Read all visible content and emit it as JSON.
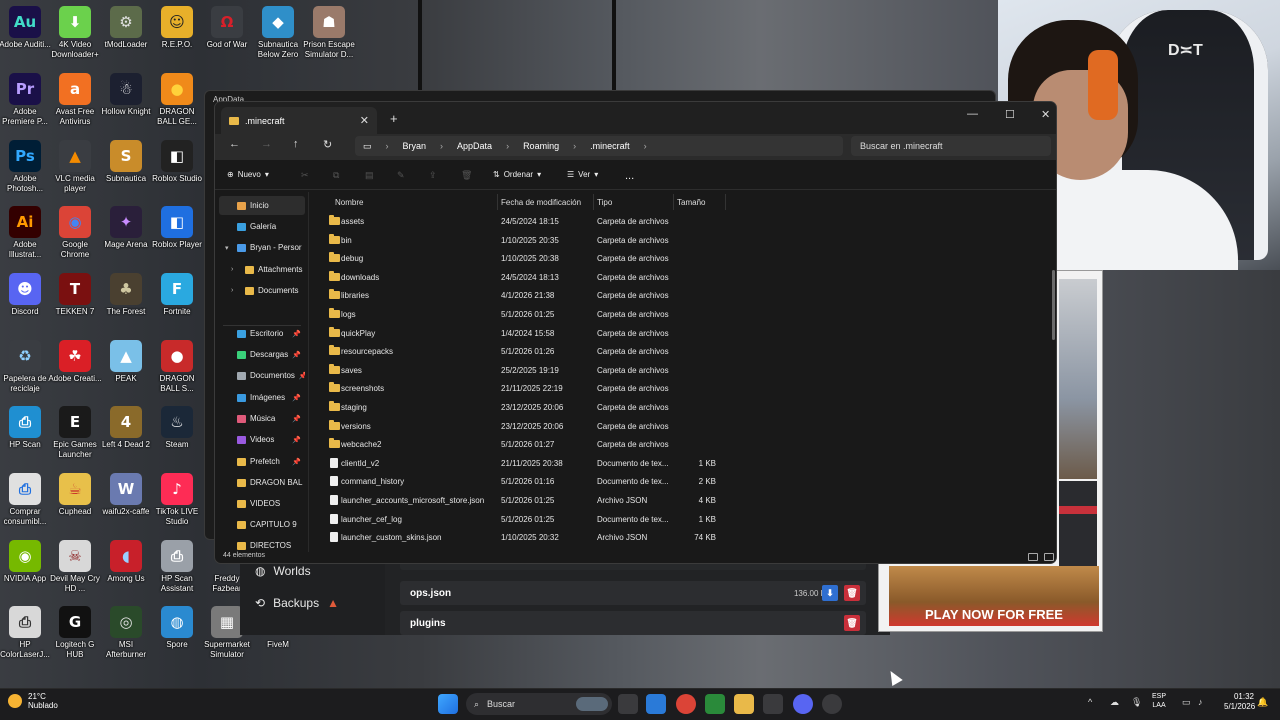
{
  "desktop_icons": [
    {
      "label": "Adobe Auditi...",
      "glyph": "Au",
      "color": "#1a1048",
      "fg": "#41dcc8",
      "icon": "audition-icon"
    },
    {
      "label": "4K Video Downloader+",
      "glyph": "⬇",
      "color": "#6bd14c",
      "fg": "#fff",
      "icon": "download-icon"
    },
    {
      "label": "tModLoader",
      "glyph": "⚙",
      "color": "#5c6b4a",
      "fg": "#e0e0e0",
      "icon": "tmodloader-icon"
    },
    {
      "label": "R.E.P.O.",
      "glyph": "☺",
      "color": "#e8b02a",
      "fg": "#222",
      "icon": "repo-icon"
    },
    {
      "label": "God of War",
      "glyph": "Ω",
      "color": "#3a3d42",
      "fg": "#d8202a",
      "icon": "godofwar-icon"
    },
    {
      "label": "Subnautica Below Zero",
      "glyph": "◆",
      "color": "#2f8fc9",
      "fg": "#fff",
      "icon": "subnautica-bz-icon"
    },
    {
      "label": "Prison Escape Simulator D...",
      "glyph": "☗",
      "color": "#9a7a6a",
      "fg": "#fff",
      "icon": "prison-escape-icon"
    },
    {
      "label": "Adobe Premiere P...",
      "glyph": "Pr",
      "color": "#1a1048",
      "fg": "#b89dff",
      "icon": "premiere-icon"
    },
    {
      "label": "Avast Free Antivirus",
      "glyph": "a",
      "color": "#f27022",
      "fg": "#fff",
      "icon": "avast-icon"
    },
    {
      "label": "Hollow Knight",
      "glyph": "☃",
      "color": "#1c2030",
      "fg": "#fff",
      "icon": "hollow-knight-icon"
    },
    {
      "label": "DRAGON BALL GE...",
      "glyph": "●",
      "color": "#f08a1a",
      "fg": "#ffd23a",
      "icon": "dragonball-icon"
    },
    {
      "label": "Adobe Photosh...",
      "glyph": "Ps",
      "color": "#001e36",
      "fg": "#31a8ff",
      "icon": "photoshop-icon"
    },
    {
      "label": "VLC media player",
      "glyph": "▲",
      "color": "#3a3d42",
      "fg": "#f48b00",
      "icon": "vlc-icon"
    },
    {
      "label": "Subnautica",
      "glyph": "S",
      "color": "#c98c2a",
      "fg": "#fff",
      "icon": "subnautica-icon"
    },
    {
      "label": "Roblox Studio",
      "glyph": "◧",
      "color": "#222",
      "fg": "#fff",
      "icon": "roblox-studio-icon"
    },
    {
      "label": "Adobe Illustrat...",
      "glyph": "Ai",
      "color": "#330000",
      "fg": "#ff9a00",
      "icon": "illustrator-icon"
    },
    {
      "label": "Google Chrome",
      "glyph": "◉",
      "color": "#db4437",
      "fg": "#4285f4",
      "icon": "chrome-icon"
    },
    {
      "label": "Mage Arena",
      "glyph": "✦",
      "color": "#2a1f3a",
      "fg": "#c98cff",
      "icon": "mage-arena-icon"
    },
    {
      "label": "Roblox Player",
      "glyph": "◧",
      "color": "#1f6fe0",
      "fg": "#fff",
      "icon": "roblox-icon"
    },
    {
      "label": "Discord",
      "glyph": "☻",
      "color": "#5865f2",
      "fg": "#fff",
      "icon": "discord-icon"
    },
    {
      "label": "TEKKEN 7",
      "glyph": "T",
      "color": "#7a1010",
      "fg": "#fff",
      "icon": "tekken-icon"
    },
    {
      "label": "The Forest",
      "glyph": "♣",
      "color": "#4a4030",
      "fg": "#cfc7a0",
      "icon": "the-forest-icon"
    },
    {
      "label": "Fortnite",
      "glyph": "F",
      "color": "#2aa9e0",
      "fg": "#fff",
      "icon": "fortnite-icon"
    },
    {
      "label": "Papelera de reciclaje",
      "glyph": "♻",
      "color": "#3a3d42",
      "fg": "#8fd0ff",
      "icon": "recycle-bin-icon"
    },
    {
      "label": "Adobe Creati...",
      "glyph": "☘",
      "color": "#da1f26",
      "fg": "#fff",
      "icon": "creative-cloud-icon"
    },
    {
      "label": "PEAK",
      "glyph": "▲",
      "color": "#7ac0e8",
      "fg": "#fff",
      "icon": "peak-icon"
    },
    {
      "label": "DRAGON BALL S...",
      "glyph": "●",
      "color": "#c82a2a",
      "fg": "#fff",
      "icon": "dragonball-s-icon"
    },
    {
      "label": "HP Scan",
      "glyph": "⎙",
      "color": "#1f8fd1",
      "fg": "#fff",
      "icon": "hp-scan-icon"
    },
    {
      "label": "Epic Games Launcher",
      "glyph": "E",
      "color": "#1a1a1a",
      "fg": "#fff",
      "icon": "epic-games-icon"
    },
    {
      "label": "Left 4 Dead 2",
      "glyph": "4",
      "color": "#8a6a2a",
      "fg": "#fff",
      "icon": "l4d2-icon"
    },
    {
      "label": "Steam",
      "glyph": "♨",
      "color": "#1b2838",
      "fg": "#fff",
      "icon": "steam-icon"
    },
    {
      "label": "Comprar consumibl...",
      "glyph": "⎙",
      "color": "#e0e0e0",
      "fg": "#1f6fe0",
      "icon": "hp-supplies-icon"
    },
    {
      "label": "Cuphead",
      "glyph": "☕",
      "color": "#e8c04a",
      "fg": "#c82a2a",
      "icon": "cuphead-icon"
    },
    {
      "label": "waifu2x-caffe",
      "glyph": "W",
      "color": "#6a7ab0",
      "fg": "#fff",
      "icon": "waifu2x-icon"
    },
    {
      "label": "TikTok LIVE Studio",
      "glyph": "♪",
      "color": "#fe2c55",
      "fg": "#fff",
      "icon": "tiktok-icon"
    },
    {
      "label": "NVIDIA App",
      "glyph": "◉",
      "color": "#76b900",
      "fg": "#fff",
      "icon": "nvidia-icon"
    },
    {
      "label": "Devil May Cry HD ...",
      "glyph": "☠",
      "color": "#d8d8d8",
      "fg": "#8a1a1a",
      "icon": "dmc-icon"
    },
    {
      "label": "Among Us",
      "glyph": "◖",
      "color": "#c8202a",
      "fg": "#9ad0ff",
      "icon": "among-us-icon"
    },
    {
      "label": "HP Scan Assistant",
      "glyph": "⎙",
      "color": "#9aa0a8",
      "fg": "#fff",
      "icon": "hp-scan-assistant-icon"
    },
    {
      "label": "HP ColorLaserJ...",
      "glyph": "⎙",
      "color": "#d8d8d8",
      "fg": "#333",
      "icon": "hp-printer-icon"
    },
    {
      "label": "Logitech G HUB",
      "glyph": "G",
      "color": "#111",
      "fg": "#fff",
      "icon": "logitech-icon"
    },
    {
      "label": "MSI Afterburner",
      "glyph": "◎",
      "color": "#2a4a2a",
      "fg": "#e0e0e0",
      "icon": "msi-icon"
    },
    {
      "label": "Spore",
      "glyph": "◍",
      "color": "#2a8ad0",
      "fg": "#fff",
      "icon": "spore-icon"
    },
    {
      "label": "Supermarket Simulator",
      "glyph": "▦",
      "color": "#7a7a7a",
      "fg": "#fff",
      "icon": "supermarket-icon"
    },
    {
      "label": "FiveM",
      "glyph": "",
      "color": "transparent",
      "fg": "#fff",
      "icon": "fivem-icon"
    },
    {
      "label": "Freddy Fazbear",
      "glyph": "",
      "color": "transparent",
      "fg": "#fff",
      "icon": "freddy-icon"
    }
  ],
  "background_window": {
    "tab_title": "AppData",
    "side_items": [
      "Worlds",
      "Backups"
    ],
    "rows": [
      {
        "name": "ops.json",
        "size": "136.00 B"
      },
      {
        "name": "plugins",
        "size": ""
      }
    ],
    "ad_text": "PLAY NOW FOR FREE"
  },
  "explorer": {
    "tab_title": ".minecraft",
    "breadcrumb": [
      "Bryan",
      "AppData",
      "Roaming",
      ".minecraft"
    ],
    "search_placeholder": "Buscar en .minecraft",
    "toolbar": {
      "new": "Nuevo",
      "sort": "Ordenar",
      "view": "Ver",
      "more": "..."
    },
    "nav": [
      {
        "label": "Inicio",
        "icon": "home-icon",
        "color": "#e8a24a",
        "selected": true,
        "pin": false,
        "chev": ""
      },
      {
        "label": "Galería",
        "icon": "gallery-icon",
        "color": "#3aa0e0",
        "selected": false,
        "pin": false,
        "chev": ""
      },
      {
        "label": "Bryan - Persor",
        "icon": "onedrive-icon",
        "color": "#4a9ae8",
        "selected": false,
        "pin": false,
        "chev": "▾"
      },
      {
        "label": "Attachments",
        "icon": "folder-icon",
        "color": "#e9b949",
        "selected": false,
        "pin": false,
        "chev": "›"
      },
      {
        "label": "Documents",
        "icon": "folder-icon",
        "color": "#e9b949",
        "selected": false,
        "pin": false,
        "chev": "›"
      },
      {
        "label": "Escritorio",
        "icon": "desktop-icon",
        "color": "#3aa0e0",
        "selected": false,
        "pin": true,
        "chev": ""
      },
      {
        "label": "Descargas",
        "icon": "downloads-icon",
        "color": "#3ad07a",
        "selected": false,
        "pin": true,
        "chev": ""
      },
      {
        "label": "Documentos",
        "icon": "documents-icon",
        "color": "#a0a8b0",
        "selected": false,
        "pin": true,
        "chev": ""
      },
      {
        "label": "Imágenes",
        "icon": "pictures-icon",
        "color": "#3a9ae0",
        "selected": false,
        "pin": true,
        "chev": ""
      },
      {
        "label": "Música",
        "icon": "music-icon",
        "color": "#e05a7a",
        "selected": false,
        "pin": true,
        "chev": ""
      },
      {
        "label": "Videos",
        "icon": "videos-icon",
        "color": "#9a5ae0",
        "selected": false,
        "pin": true,
        "chev": ""
      },
      {
        "label": "Prefetch",
        "icon": "folder-icon",
        "color": "#e9b949",
        "selected": false,
        "pin": true,
        "chev": ""
      },
      {
        "label": "DRAGON BAL",
        "icon": "folder-icon",
        "color": "#e9b949",
        "selected": false,
        "pin": false,
        "chev": ""
      },
      {
        "label": "VIDEOS",
        "icon": "folder-icon",
        "color": "#e9b949",
        "selected": false,
        "pin": false,
        "chev": ""
      },
      {
        "label": "CAPITULO 9",
        "icon": "folder-icon",
        "color": "#e9b949",
        "selected": false,
        "pin": false,
        "chev": ""
      },
      {
        "label": "DIRECTOS",
        "icon": "folder-icon",
        "color": "#e9b949",
        "selected": false,
        "pin": false,
        "chev": ""
      }
    ],
    "columns": {
      "name": "Nombre",
      "date": "Fecha de modificación",
      "type": "Tipo",
      "size": "Tamaño"
    },
    "files": [
      {
        "name": "assets",
        "date": "24/5/2024 18:15",
        "type": "Carpeta de archivos",
        "size": "",
        "kind": "folder"
      },
      {
        "name": "bin",
        "date": "1/10/2025 20:35",
        "type": "Carpeta de archivos",
        "size": "",
        "kind": "folder"
      },
      {
        "name": "debug",
        "date": "1/10/2025 20:38",
        "type": "Carpeta de archivos",
        "size": "",
        "kind": "folder"
      },
      {
        "name": "downloads",
        "date": "24/5/2024 18:13",
        "type": "Carpeta de archivos",
        "size": "",
        "kind": "folder"
      },
      {
        "name": "libraries",
        "date": "4/1/2026 21:38",
        "type": "Carpeta de archivos",
        "size": "",
        "kind": "folder"
      },
      {
        "name": "logs",
        "date": "5/1/2026 01:25",
        "type": "Carpeta de archivos",
        "size": "",
        "kind": "folder"
      },
      {
        "name": "quickPlay",
        "date": "1/4/2024 15:58",
        "type": "Carpeta de archivos",
        "size": "",
        "kind": "folder"
      },
      {
        "name": "resourcepacks",
        "date": "5/1/2026 01:26",
        "type": "Carpeta de archivos",
        "size": "",
        "kind": "folder"
      },
      {
        "name": "saves",
        "date": "25/2/2025 19:19",
        "type": "Carpeta de archivos",
        "size": "",
        "kind": "folder"
      },
      {
        "name": "screenshots",
        "date": "21/11/2025 22:19",
        "type": "Carpeta de archivos",
        "size": "",
        "kind": "folder"
      },
      {
        "name": "staging",
        "date": "23/12/2025 20:06",
        "type": "Carpeta de archivos",
        "size": "",
        "kind": "folder"
      },
      {
        "name": "versions",
        "date": "23/12/2025 20:06",
        "type": "Carpeta de archivos",
        "size": "",
        "kind": "folder"
      },
      {
        "name": "webcache2",
        "date": "5/1/2026 01:27",
        "type": "Carpeta de archivos",
        "size": "",
        "kind": "folder"
      },
      {
        "name": "clientId_v2",
        "date": "21/11/2025 20:38",
        "type": "Documento de tex...",
        "size": "1 KB",
        "kind": "file"
      },
      {
        "name": "command_history",
        "date": "5/1/2026 01:16",
        "type": "Documento de tex...",
        "size": "2 KB",
        "kind": "file"
      },
      {
        "name": "launcher_accounts_microsoft_store.json",
        "date": "5/1/2026 01:25",
        "type": "Archivo JSON",
        "size": "4 KB",
        "kind": "file"
      },
      {
        "name": "launcher_cef_log",
        "date": "5/1/2026 01:25",
        "type": "Documento de tex...",
        "size": "1 KB",
        "kind": "file"
      },
      {
        "name": "launcher_custom_skins.json",
        "date": "1/10/2025 20:32",
        "type": "Archivo JSON",
        "size": "74 KB",
        "kind": "file"
      }
    ],
    "status": "44 elementos"
  },
  "taskbar": {
    "temperature": "21°C",
    "weather": "Nublado",
    "search": "Buscar",
    "lang_top": "ESP",
    "lang_bottom": "LAA",
    "time": "01:32",
    "date": "5/1/2026"
  }
}
